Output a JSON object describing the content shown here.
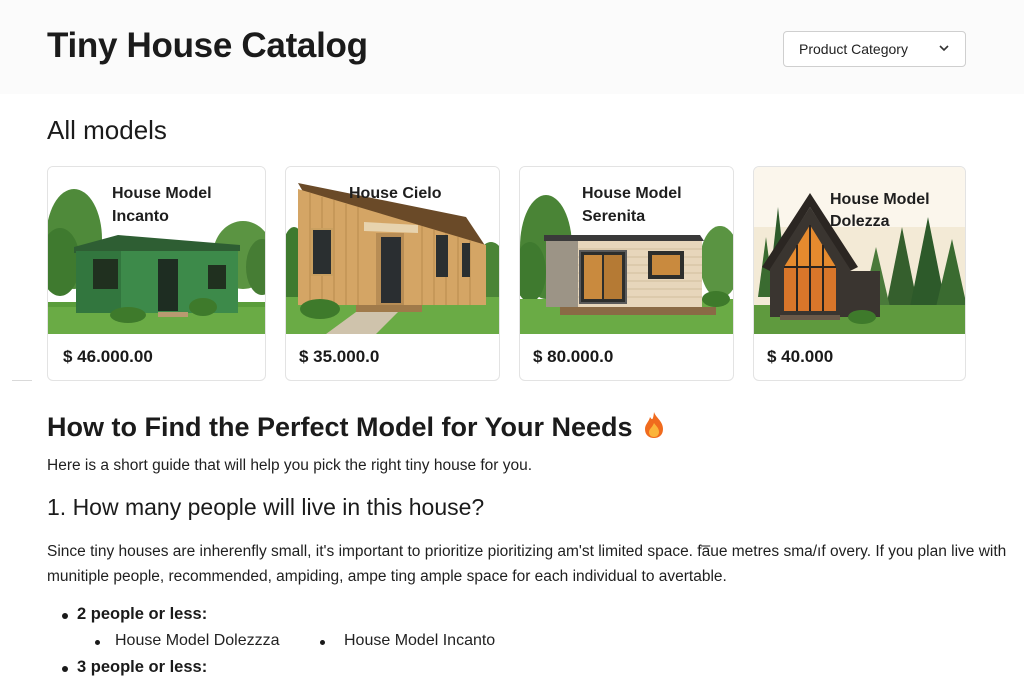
{
  "header": {
    "title": "Tiny House Catalog",
    "category_select": "Product Category"
  },
  "models_section": {
    "title": "All models",
    "cards": [
      {
        "name_line1": "House Model",
        "name_line2": "Incanto",
        "price": "$ 46.000.00"
      },
      {
        "name_line1": "House Cielo",
        "name_line2": "",
        "price": "$ 35.000.0"
      },
      {
        "name_line1": "House Model",
        "name_line2": "Serenita",
        "price": "$ 80.000.0"
      },
      {
        "name_line1": "House Model",
        "name_line2": "Dolezza",
        "price": "$ 40.000"
      }
    ]
  },
  "guide": {
    "title": "How to Find the Perfect Model for Your Needs",
    "intro": "Here is a short guide that will help you pick the right tiny house for you.",
    "q1_title": "1. How many people will live in this house?",
    "paragraph": "Since tiny houses are inherenfly small, it's important to prioritize pioritizing am'st limited space. fa̅ue metres sma/ıf overy. If you plan live with munitiple people, recommended, ampiding, ampe ting  ample space for each individual to avertable.",
    "groups": [
      {
        "label": "2 people or less:",
        "models": [
          "House Model  Dolezzza",
          "House Model Incanto"
        ]
      },
      {
        "label": "3 people or less:",
        "models": []
      }
    ]
  },
  "colors": {
    "text": "#1a1a1a",
    "card_border": "#e3e3e3",
    "header_bg": "#fbfbfb"
  }
}
